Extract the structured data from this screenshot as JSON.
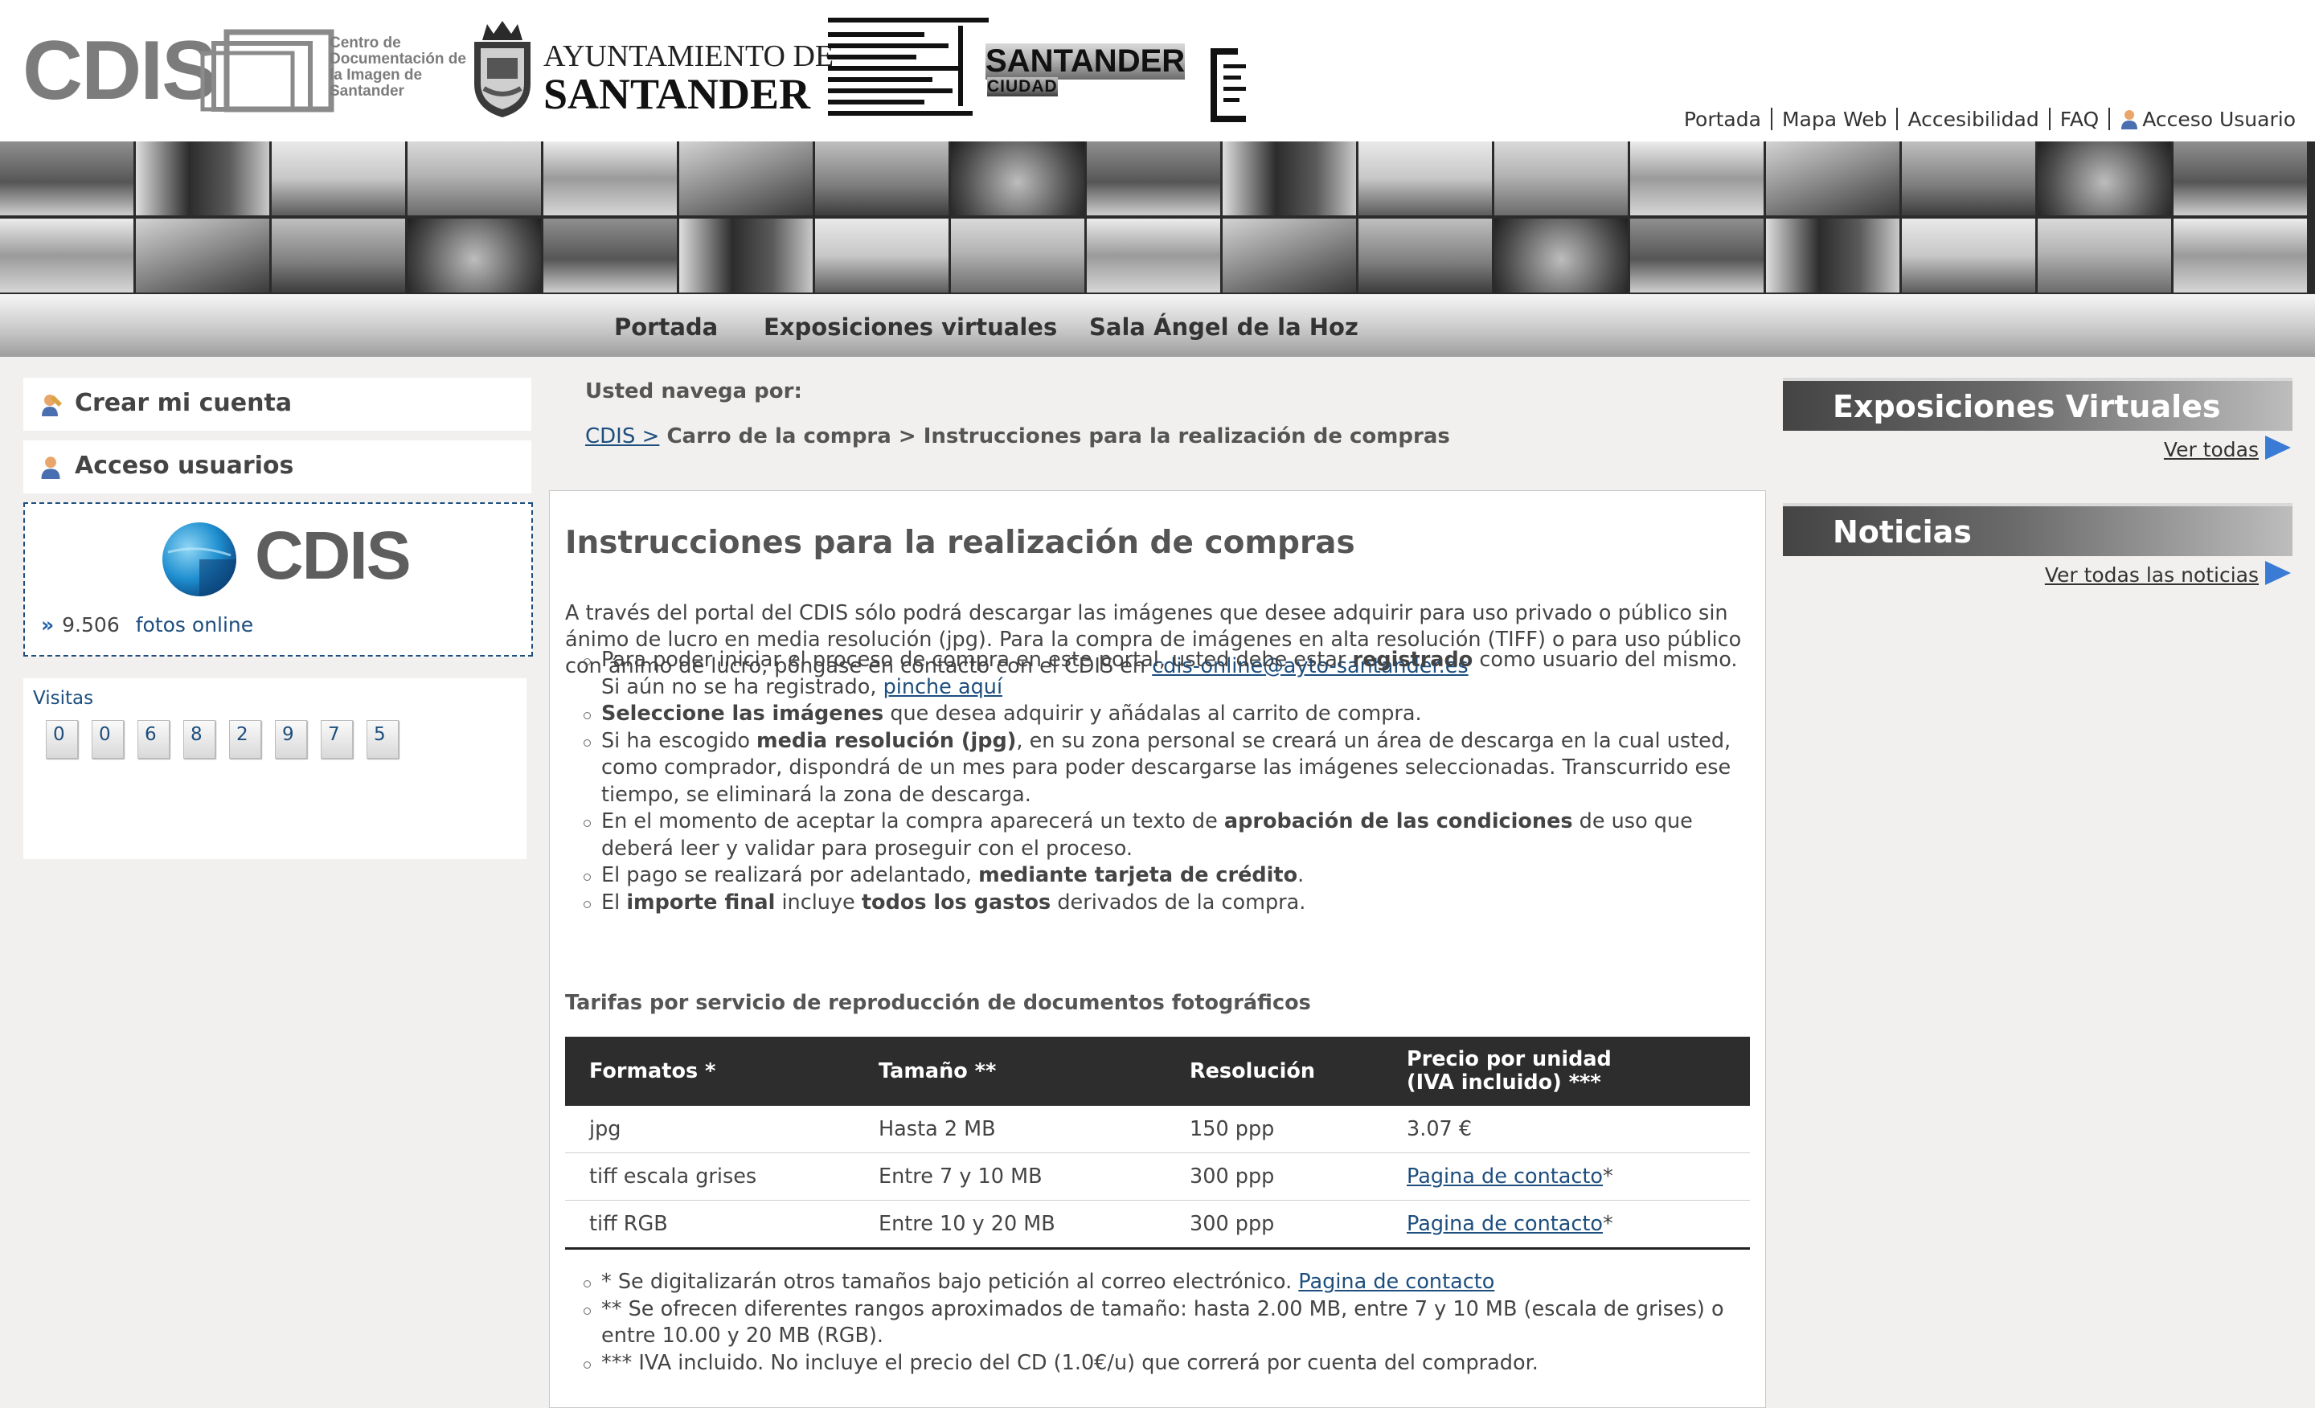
{
  "header": {
    "cdis_logo_text": "CDIS",
    "cdis_logo_sub": "Centro de Documentación de la Imagen de Santander",
    "ayto_line1": "AYUNTAMIENTO DE",
    "ayto_line2": "SANTANDER",
    "ciudad_line1": "SANTANDER",
    "ciudad_line2": "CIUDAD",
    "top_links": [
      "Portada",
      "Mapa Web",
      "Accesibilidad",
      "FAQ",
      "Acceso Usuario"
    ]
  },
  "nav": {
    "items": [
      "Portada",
      "Exposiciones virtuales",
      "Sala Ángel de la Hoz"
    ]
  },
  "sidebar_left": {
    "crear_cuenta": "Crear mi cuenta",
    "acceso_usuarios": "Acceso usuarios",
    "cdis_word": "CDIS",
    "photos_count": "9.506",
    "photos_label": "fotos online",
    "visitas_label": "Visitas",
    "visit_digits": [
      "0",
      "0",
      "6",
      "8",
      "2",
      "9",
      "7",
      "5"
    ]
  },
  "breadcrumb": {
    "label": "Usted navega por:",
    "root": "CDIS >",
    "trail": "Carro de la compra > Instrucciones para la realización de compras"
  },
  "content": {
    "title": "Instrucciones para la realización de compras",
    "intro": "A través del portal del CDIS sólo podrá descargar las imágenes que desee adquirir para uso privado o público sin ánimo de lucro en media resolución (jpg). Para la compra de imágenes en alta resolución (TIFF) o para uso público con ánimo de lucro, póngase en contacto con el CDIS en",
    "email": "cdis-online@ayto-santander.es",
    "bullets": [
      {
        "a": "Para poder iniciar el proceso de compra en este portal, usted debe estar ",
        "b": "registrado",
        "c": " como usuario del mismo. Si aún no se ha registrado, ",
        "link": "pinche aquí"
      },
      {
        "b": "Seleccione las imágenes",
        "c": " que desea adquirir y añádalas al carrito de compra."
      },
      {
        "a": "Si ha escogido ",
        "b": "media resolución (jpg)",
        "c": ", en su zona personal se creará un área de descarga en la cual usted, como comprador, dispondrá de un mes para poder descargarse las imágenes seleccionadas. Transcurrido ese tiempo, se eliminará la zona de descarga."
      },
      {
        "a": "En el momento de aceptar la compra aparecerá un texto de ",
        "b": "aprobación de las condiciones",
        "c": " de uso que deberá leer y validar para proseguir con el proceso."
      },
      {
        "a": "El pago se realizará por adelantado, ",
        "b": "mediante tarjeta de crédito",
        "c": "."
      },
      {
        "a": "El ",
        "b": "importe final",
        "c": " incluye ",
        "b2": "todos los gastos",
        "d": " derivados de la compra."
      }
    ],
    "tarifas_title": "Tarifas por servicio de reproducción de documentos fotográficos",
    "table": {
      "headers": [
        "Formatos *",
        "Tamaño **",
        "Resolución",
        "Precio por unidad",
        "(IVA incluido) ***"
      ],
      "rows": [
        {
          "formato": "jpg",
          "tamano": "Hasta 2 MB",
          "resolucion": "150 ppp",
          "precio": "3.07 €"
        },
        {
          "formato": "tiff escala grises",
          "tamano": "Entre 7 y 10 MB",
          "resolucion": "300 ppp",
          "precio_link": "Pagina de contacto",
          "precio_suffix": "*"
        },
        {
          "formato": "tiff RGB",
          "tamano": "Entre 10 y 20 MB",
          "resolucion": "300 ppp",
          "precio_link": "Pagina de contacto",
          "precio_suffix": "*"
        }
      ]
    },
    "notes": [
      {
        "text": "* Se digitalizarán otros tamaños bajo petición al correo electrónico. ",
        "link": "Pagina de contacto"
      },
      {
        "text": "** Se ofrecen diferentes rangos aproximados de tamaño: hasta 2.00 MB, entre 7 y 10 MB (escala de grises) o entre 10.00 y 20 MB (RGB)."
      },
      {
        "text": "*** IVA incluido. No incluye el precio del CD (1.0€/u) que correrá por cuenta del comprador."
      }
    ]
  },
  "sidebar_right": {
    "expos_title": "Exposiciones Virtuales",
    "expos_link": "Ver todas",
    "news_title": "Noticias",
    "news_link": "Ver todas las noticias"
  },
  "colors": {
    "link": "#1d4e7e",
    "table_header": "#2d2d2d",
    "arrow": "#3a7bd5"
  },
  "icons": [
    "user-icon",
    "pen-user-icon",
    "double-chevron-icon",
    "triangle-arrow-icon",
    "globe-icon"
  ]
}
